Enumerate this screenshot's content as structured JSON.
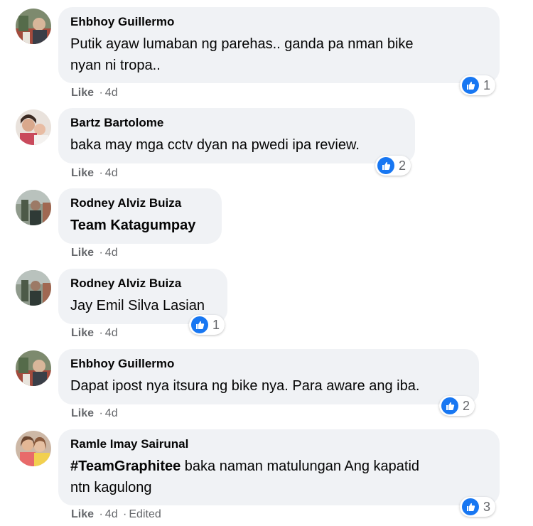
{
  "colors": {
    "bubble": "#f0f2f5",
    "text": "#050505",
    "meta": "#65676b",
    "like_blue": "#1877f2"
  },
  "comments": [
    {
      "author": "Ehbhoy Guillermo",
      "text_lines": [
        "Putik ayaw lumaban ng parehas.. ganda pa nman bike",
        "nyan ni tropa.."
      ],
      "like_label": "Like",
      "sep": "·",
      "time": "4d",
      "reactions": "1",
      "icon": "thumbs-up-icon"
    },
    {
      "author": "Bartz Bartolome",
      "text_lines": [
        "baka may mga cctv dyan na pwedi ipa review."
      ],
      "like_label": "Like",
      "sep": "·",
      "time": "4d",
      "reactions": "2",
      "icon": "thumbs-up-icon"
    },
    {
      "author": "Rodney Alviz Buiza",
      "text_lines": [
        "Team Katagumpay"
      ],
      "like_label": "Like",
      "sep": "·",
      "time": "4d"
    },
    {
      "author": "Rodney Alviz Buiza",
      "text_lines": [
        "Jay Emil Silva Lasian"
      ],
      "like_label": "Like",
      "sep": "·",
      "time": "4d",
      "reactions": "1",
      "icon": "thumbs-up-icon"
    },
    {
      "author": "Ehbhoy Guillermo",
      "text_lines": [
        "Dapat ipost nya itsura ng bike nya. Para aware ang iba."
      ],
      "like_label": "Like",
      "sep": "·",
      "time": "4d",
      "reactions": "2",
      "icon": "thumbs-up-icon"
    },
    {
      "author": "Ramle Imay Sairunal",
      "hashtag": "#TeamGraphitee",
      "text_lines": [
        " baka naman matulungan Ang kapatid",
        "ntn kagulong"
      ],
      "like_label": "Like",
      "sep": "·",
      "time": "4d",
      "edited": "Edited",
      "reactions": "3",
      "icon": "thumbs-up-icon"
    }
  ]
}
